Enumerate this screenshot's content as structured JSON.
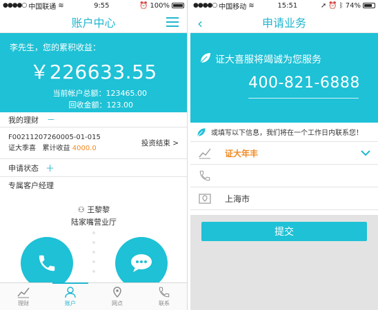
{
  "left": {
    "status": {
      "carrier": "中国联通",
      "time": "9:55",
      "battery": "100%",
      "battery_fraction": 1.0
    },
    "nav": {
      "title": "账户中心",
      "menu_icon": "hamburger-icon"
    },
    "hero": {
      "greeting": "李先生，您的累积收益：",
      "amount": "￥226633.55",
      "total_label": "当前帐户总额：123465.00",
      "returned_label": "回收金额：123.00"
    },
    "my_finance": {
      "title": "我的理财",
      "mark": "－"
    },
    "product": {
      "code": "F00211207260005-01-015",
      "name": "证大季喜",
      "accum_label": "累计收益",
      "accum_value": "4000.0",
      "status": "投资结束",
      "chevron": ">"
    },
    "apply_status": {
      "title": "申请状态",
      "mark": "＋"
    },
    "manager": {
      "section_title": "专属客户经理",
      "name": "王黎黎",
      "branch": "陆家嘴营业厅",
      "call_icon": "phone-icon",
      "chat_icon": "chat-bubble-icon"
    },
    "tabs": [
      {
        "label": "理财",
        "icon": "chart-icon",
        "active": false
      },
      {
        "label": "账户",
        "icon": "user-icon",
        "active": true
      },
      {
        "label": "网点",
        "icon": "map-pin-icon",
        "active": false
      },
      {
        "label": "联系",
        "icon": "phone-icon",
        "active": false
      }
    ]
  },
  "right": {
    "status": {
      "carrier": "中国移动",
      "time": "15:51",
      "battery": "74%",
      "battery_fraction": 0.74
    },
    "nav": {
      "title": "申请业务",
      "back": "‹"
    },
    "hero": {
      "slogan": "证大喜服将竭诚为您服务",
      "phone": "400-821-6888"
    },
    "note": "或填写以下信息，我们将在一个工作日内联系您！",
    "fields": {
      "product": "证大年丰",
      "phone": "",
      "city": "上海市"
    },
    "submit_label": "提交"
  },
  "colors": {
    "accent": "#1ec1d6",
    "highlight": "#f08a24",
    "gray_bg": "#e3e3e3"
  }
}
